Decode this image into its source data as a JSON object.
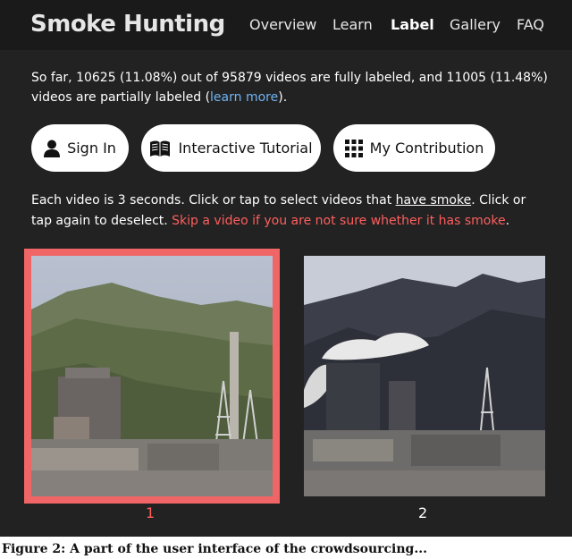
{
  "header": {
    "brand": "Smoke Hunting",
    "nav": [
      {
        "label": "Overview",
        "active": false
      },
      {
        "label": "Learn",
        "active": false
      },
      {
        "label": "Label",
        "active": true
      },
      {
        "label": "Gallery",
        "active": false
      },
      {
        "label": "FAQ",
        "active": false
      }
    ]
  },
  "stats": {
    "text_before": "So far, 10625 (11.08%) out of 95879 videos are fully labeled, and 11005 (11.48%) videos are partially labeled (",
    "link": "learn more",
    "text_after": ")."
  },
  "buttons": {
    "sign_in": "Sign In",
    "tutorial": "Interactive Tutorial",
    "contribution": "My Contribution"
  },
  "instructions": {
    "part1": "Each video is 3 seconds. Click or tap to select videos that ",
    "underlined": "have smoke",
    "part2": ". Click or tap again to deselect. ",
    "warning": "Skip a video if you are not sure whether it has smoke",
    "part3": "."
  },
  "videos": [
    {
      "caption": "1",
      "selected": true
    },
    {
      "caption": "2",
      "selected": false
    }
  ],
  "figure_caption": "Figure 2: A part of the user interface of the crowdsourcing..."
}
